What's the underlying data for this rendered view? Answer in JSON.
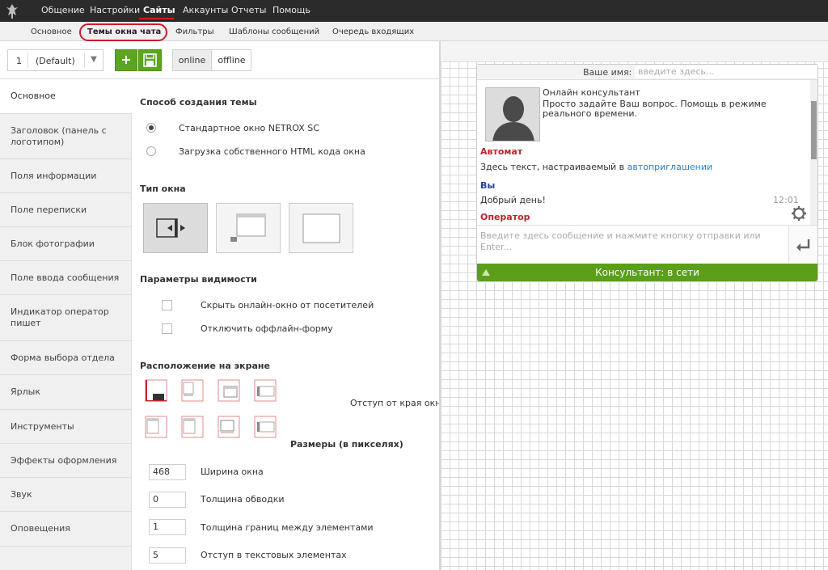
{
  "topnav": {
    "items": [
      {
        "label": "Общение"
      },
      {
        "label": "Настройки"
      },
      {
        "label": "Сайты"
      },
      {
        "label": "Аккаунты"
      },
      {
        "label": "Отчеты"
      },
      {
        "label": "Помощь"
      }
    ],
    "active_index": 2
  },
  "subnav": {
    "items": [
      {
        "label": "Основное"
      },
      {
        "label": "Темы окна чата"
      },
      {
        "label": "Фильтры"
      },
      {
        "label": "Шаблоны сообщений"
      },
      {
        "label": "Очередь входящих"
      }
    ],
    "active_index": 1,
    "highlight_color": "#c8202a"
  },
  "toolbar": {
    "theme_number": "1",
    "theme_name": "(Default)",
    "add_label": "+",
    "online_label": "online",
    "offline_label": "offline",
    "accent_color": "#5ca61f"
  },
  "sidebar": {
    "items": [
      {
        "label": "Основное"
      },
      {
        "label": "Заголовок (панель с логотипом)"
      },
      {
        "label": "Поля информации"
      },
      {
        "label": "Поле переписки"
      },
      {
        "label": "Блок фотографии"
      },
      {
        "label": "Поле ввода сообщения"
      },
      {
        "label": "Индикатор оператор пишет"
      },
      {
        "label": "Форма выбора отдела"
      },
      {
        "label": "Ярлык"
      },
      {
        "label": "Инструменты"
      },
      {
        "label": "Эффекты оформления"
      },
      {
        "label": "Звук"
      },
      {
        "label": "Оповещения"
      }
    ],
    "active_index": 0
  },
  "main": {
    "creation_title": "Способ создания темы",
    "creation_option_1": "Стандартное окно NETROX SC",
    "creation_option_2": "Загрузка собственного HTML кода окна",
    "window_type_title": "Тип окна",
    "visibility_title": "Параметры видимости",
    "visibility_option_1": "Скрыть онлайн-окно от посетителей",
    "visibility_option_2": "Отключить оффлайн-форму",
    "position_title": "Расположение на экране",
    "edge_offset_label": "Отступ от края окна",
    "sizes_title": "Размеры (в пикселях)",
    "sizes": [
      {
        "value": "468",
        "label": "Ширина окна"
      },
      {
        "value": "0",
        "label": "Толщина обводки"
      },
      {
        "value": "1",
        "label": "Толщина границ между элементами"
      },
      {
        "value": "5",
        "label": "Отступ в текстовых элементах"
      }
    ]
  },
  "chat": {
    "name_label": "Ваше имя:",
    "name_placeholder": "введите здесь...",
    "operator_title": "Онлайн консультант",
    "operator_text": "Просто задайте Ваш вопрос. Помощь в режиме реального времени.",
    "auto_sender": "Автомат",
    "auto_text": "Здесь текст, настраиваемый в ",
    "auto_link": "автоприглашении",
    "you_sender": "Вы",
    "you_text": "Добрый день!",
    "you_time": "12:01",
    "operator_sender": "Оператор",
    "input_placeholder": "Введите здесь сообщение и нажмите кнопку отправки или Enter...",
    "status_text": "Консультант: в сети",
    "colors": {
      "auto_sender": "#c0242b",
      "you_sender": "#2a3f9e",
      "operator_sender": "#c0242b",
      "link": "#2d7fc1",
      "status_bar": "#5b9e1a"
    }
  }
}
